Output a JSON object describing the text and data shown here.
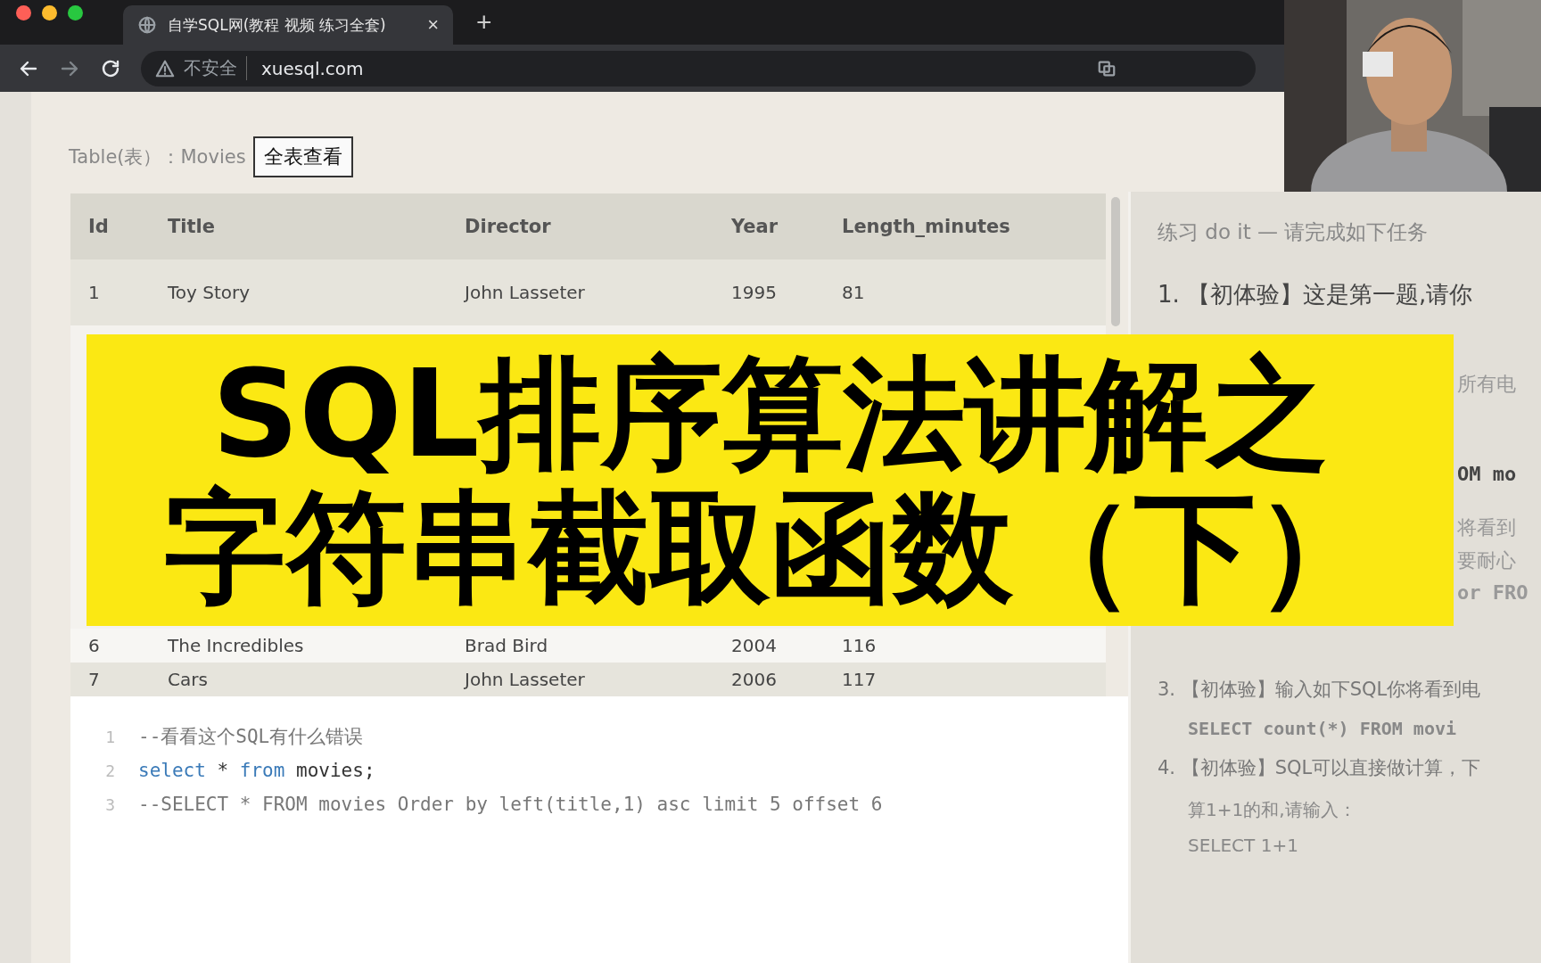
{
  "browser": {
    "tab_title": "自学SQL网(教程 视频 练习全套)",
    "tab_close": "×",
    "new_tab": "+",
    "security": "不安全",
    "url": "xuesql.com"
  },
  "table_label": "Table(表）：Movies",
  "view_all_button": "全表查看",
  "table": {
    "columns": [
      "Id",
      "Title",
      "Director",
      "Year",
      "Length_minutes"
    ],
    "rows": [
      {
        "cells": [
          "1",
          "Toy Story",
          "John Lasseter",
          "1995",
          "81"
        ]
      },
      {
        "cells": [
          "6",
          "The Incredibles",
          "Brad Bird",
          "2004",
          "116"
        ]
      },
      {
        "cells": [
          "7",
          "Cars",
          "John Lasseter",
          "2006",
          "117"
        ]
      }
    ]
  },
  "editor": {
    "lines": [
      {
        "number": "1",
        "tokens": [
          {
            "kind": "comment",
            "text": "--看看这个SQL有什么错误"
          }
        ]
      },
      {
        "number": "2",
        "tokens": [
          {
            "kind": "keyword",
            "text": "select"
          },
          {
            "kind": "plain",
            "text": " * "
          },
          {
            "kind": "keyword",
            "text": "from"
          },
          {
            "kind": "plain",
            "text": " movies;"
          }
        ]
      },
      {
        "number": "3",
        "tokens": [
          {
            "kind": "comment",
            "text": "--SELECT * FROM movies Order by left(title,1) asc limit 5 offset 6"
          }
        ]
      }
    ]
  },
  "exercise_panel": {
    "heading": "练习 do it — 请完成如下任务",
    "lines": [
      {
        "kind": "lead_task",
        "number": "1.",
        "text": "【初体验】这是第一题,请你"
      },
      {
        "kind": "fragment",
        "text": "所有电"
      },
      {
        "kind": "fragment_code",
        "text": "OM mo"
      },
      {
        "kind": "fragment",
        "text": "将看到"
      },
      {
        "kind": "fragment",
        "text": "要耐心"
      },
      {
        "kind": "fragment_code",
        "text": "or FRO"
      },
      {
        "kind": "task",
        "number": "3.",
        "text": "【初体验】输入如下SQL你将看到电"
      },
      {
        "kind": "code",
        "text": "SELECT count(*) FROM movi"
      },
      {
        "kind": "task",
        "number": "4.",
        "text": "【初体验】SQL可以直接做计算，下"
      },
      {
        "kind": "text",
        "text": "算1+1的和,请输入："
      },
      {
        "kind": "text",
        "text": "SELECT 1+1"
      }
    ]
  },
  "banner": {
    "lines": [
      "SQL排序算法讲解之",
      "字符串截取函数（下）"
    ]
  }
}
